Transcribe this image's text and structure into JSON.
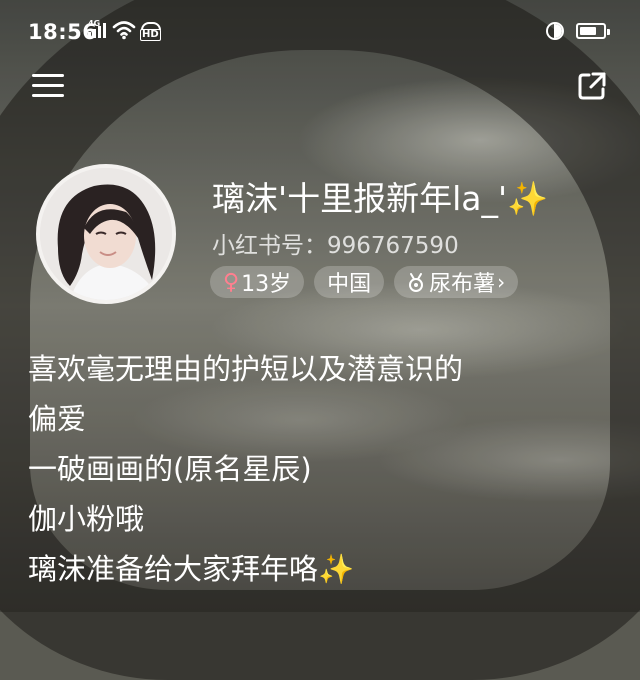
{
  "status_bar": {
    "time": "18:56",
    "network": "4G",
    "hd_label": "HD"
  },
  "nav": {
    "menu_icon": "menu-icon",
    "share_icon": "share-icon"
  },
  "profile": {
    "nickname": "璃沫'十里报新年la_'",
    "nickname_emoji": "✨",
    "account_id": "小红书号：996767590",
    "tags": [
      {
        "label": "13岁",
        "icon": "female-icon"
      },
      {
        "label": "中国"
      },
      {
        "label": "尿布薯",
        "icon": "badge-icon"
      }
    ]
  },
  "bio": {
    "lines": [
      "喜欢毫无理由的护短以及潜意识的",
      "偏爱",
      "一破画画的(原名星辰)",
      "伽小粉哦",
      "璃沫准备给大家拜年咯"
    ],
    "last_line_emoji": "✨"
  },
  "colors": {
    "female_symbol": "#ff7f8f",
    "sparkle": "#f6d34a",
    "tag_background": "rgba(255,255,255,0.22)"
  }
}
